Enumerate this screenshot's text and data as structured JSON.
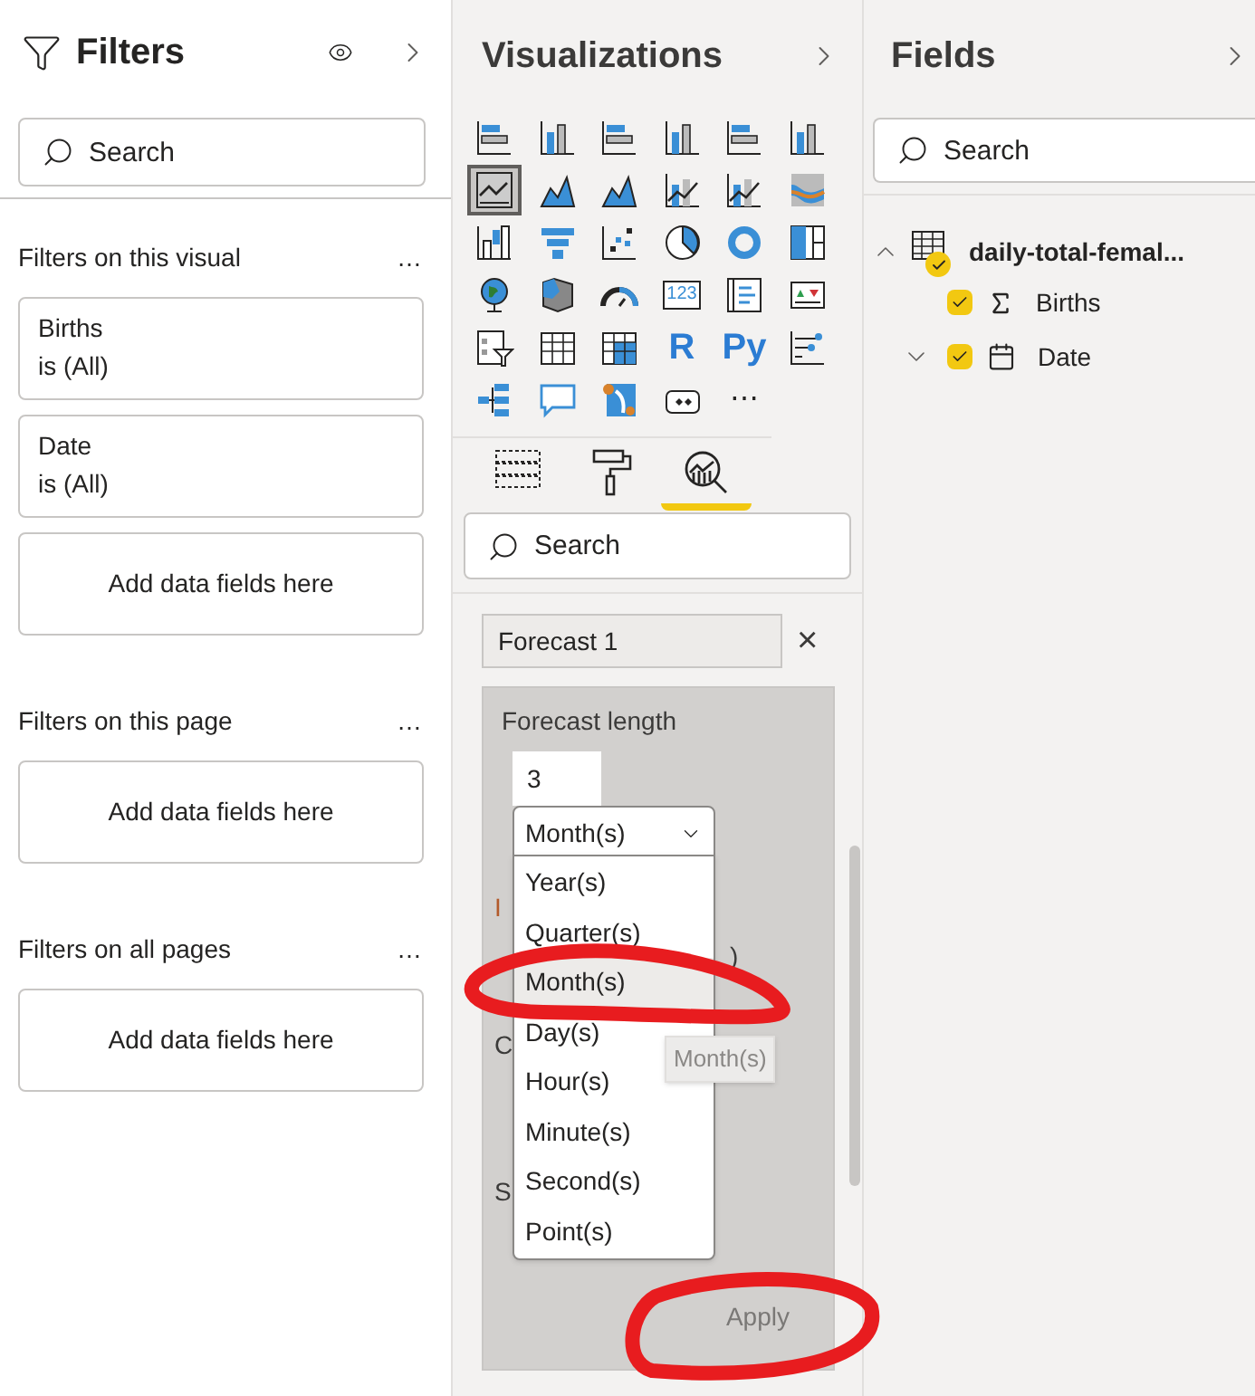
{
  "filters": {
    "title": "Filters",
    "search": {
      "placeholder": "Search"
    },
    "sections": [
      {
        "title": "Filters on this visual",
        "more": "…",
        "cards": [
          {
            "field": "Births",
            "value": "is (All)"
          },
          {
            "field": "Date",
            "value": "is (All)"
          }
        ],
        "drop": "Add data fields here"
      },
      {
        "title": "Filters on this page",
        "more": "…",
        "drop": "Add data fields here"
      },
      {
        "title": "Filters on all pages",
        "more": "…",
        "drop": "Add data fields here"
      }
    ]
  },
  "visualizations": {
    "title": "Visualizations",
    "icons": [
      {
        "kind": "hbar",
        "selected": false
      },
      {
        "kind": "col",
        "selected": false
      },
      {
        "kind": "hbar",
        "selected": false
      },
      {
        "kind": "col",
        "selected": false
      },
      {
        "kind": "hbar",
        "selected": false
      },
      {
        "kind": "col",
        "selected": false
      },
      {
        "kind": "line",
        "selected": true
      },
      {
        "kind": "area",
        "selected": false
      },
      {
        "kind": "area",
        "selected": false
      },
      {
        "kind": "linecol",
        "selected": false
      },
      {
        "kind": "linecol",
        "selected": false
      },
      {
        "kind": "ribbon",
        "selected": false
      },
      {
        "kind": "waterfall",
        "selected": false
      },
      {
        "kind": "funnel",
        "selected": false
      },
      {
        "kind": "scatter",
        "selected": false
      },
      {
        "kind": "pie",
        "selected": false
      },
      {
        "kind": "donut",
        "selected": false
      },
      {
        "kind": "treemap",
        "selected": false
      },
      {
        "kind": "globe",
        "selected": false
      },
      {
        "kind": "map",
        "selected": false
      },
      {
        "kind": "gauge",
        "selected": false
      },
      {
        "kind": "card",
        "label": "123",
        "selected": false
      },
      {
        "kind": "multirow",
        "selected": false
      },
      {
        "kind": "kpi",
        "selected": false
      },
      {
        "kind": "slicer",
        "selected": false
      },
      {
        "kind": "table",
        "selected": false
      },
      {
        "kind": "matrix",
        "selected": false
      },
      {
        "kind": "glyph",
        "label": "R",
        "selected": false
      },
      {
        "kind": "glyph",
        "label": "Py",
        "selected": false
      },
      {
        "kind": "influencers",
        "selected": false
      },
      {
        "kind": "tree",
        "selected": false
      },
      {
        "kind": "bubble",
        "selected": false
      },
      {
        "kind": "azuremap",
        "selected": false
      },
      {
        "kind": "apps",
        "selected": false
      },
      {
        "kind": "more",
        "label": "⋯",
        "selected": false
      }
    ],
    "tabs": [
      {
        "kind": "fields",
        "selected": false
      },
      {
        "kind": "format",
        "selected": false
      },
      {
        "kind": "analytics",
        "selected": true
      }
    ],
    "search": {
      "placeholder": "Search"
    },
    "forecast": {
      "name": "Forecast 1",
      "close": "×",
      "length_label": "Forecast length",
      "length": "3",
      "unit": "Month(s)",
      "hidden_labels": [
        {
          "text": "I",
          "warn": true
        },
        {
          "text": ")",
          "warn": false
        },
        {
          "text": "C",
          "warn": false
        },
        {
          "text": "S",
          "warn": false
        }
      ],
      "options": [
        {
          "label": "Year(s)",
          "selected": false
        },
        {
          "label": "Quarter(s)",
          "selected": false
        },
        {
          "label": "Month(s)",
          "selected": true
        },
        {
          "label": "Day(s)",
          "selected": false
        },
        {
          "label": "Hour(s)",
          "selected": false
        },
        {
          "label": "Minute(s)",
          "selected": false
        },
        {
          "label": "Second(s)",
          "selected": false
        },
        {
          "label": "Point(s)",
          "selected": false
        }
      ],
      "tooltip": "Month(s)",
      "apply": {
        "label": "Apply",
        "disabled": true
      }
    }
  },
  "fields": {
    "title": "Fields",
    "search": {
      "placeholder": "Search"
    },
    "tables": [
      {
        "name": "daily-total-femal...",
        "expanded": true,
        "checked": true,
        "children": [
          {
            "name": "Births",
            "kind": "measure",
            "checked": true
          },
          {
            "name": "Date",
            "kind": "date",
            "checked": true,
            "expanded": false
          }
        ]
      }
    ]
  }
}
